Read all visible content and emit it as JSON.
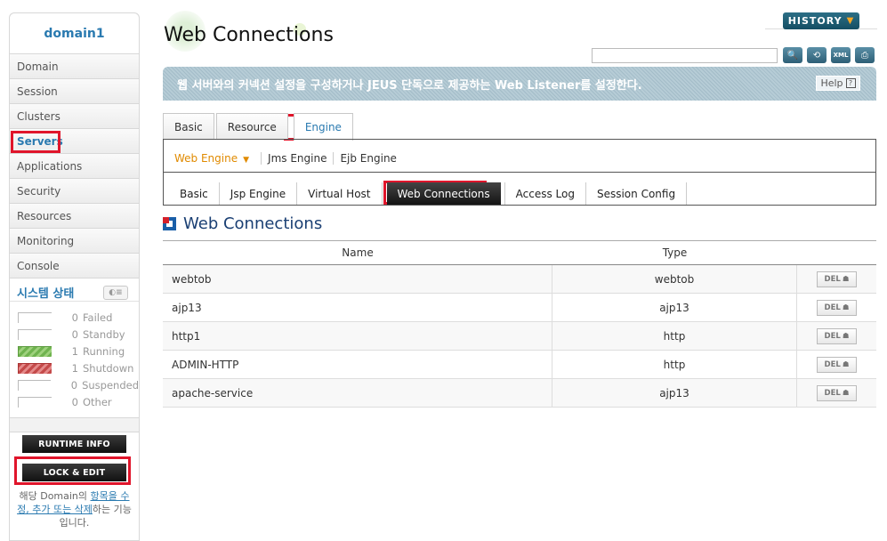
{
  "sidebar": {
    "domain": "domain1",
    "items": [
      {
        "label": "Domain"
      },
      {
        "label": "Session"
      },
      {
        "label": "Clusters"
      },
      {
        "label": "Servers"
      },
      {
        "label": "Applications"
      },
      {
        "label": "Security"
      },
      {
        "label": "Resources"
      },
      {
        "label": "Monitoring"
      },
      {
        "label": "Console"
      }
    ],
    "status_title": "시스템 상태",
    "status_toggle": "◐≡",
    "status": [
      {
        "count": "0",
        "label": "Failed"
      },
      {
        "count": "0",
        "label": "Standby"
      },
      {
        "count": "1",
        "label": "Running"
      },
      {
        "count": "1",
        "label": "Shutdown"
      },
      {
        "count": "0",
        "label": "Suspended"
      },
      {
        "count": "0",
        "label": "Other"
      }
    ],
    "runtime_btn": "RUNTIME INFO",
    "lock_btn": "LOCK & EDIT",
    "note_pre": "해당 Domain의 ",
    "note_link1": "항목을 수정, 추가 또는 삭제",
    "note_post": "하는 기능입니다."
  },
  "header": {
    "title": "Web Connections",
    "history": "HISTORY",
    "history_chevron": "❯",
    "search_value": "",
    "tools": [
      "🔍",
      "⟲",
      "XML",
      "⎙"
    ]
  },
  "banner": {
    "text": "웹 서버와의 커넥션 설정을 구성하거나 JEUS 단독으로 제공하는 Web Listener를 설정한다.",
    "help": "Help",
    "help_icon": "?"
  },
  "tabs1": [
    "Basic",
    "Resource",
    "Engine"
  ],
  "sub1": [
    "Web Engine",
    "Jms Engine",
    "Ejb Engine"
  ],
  "tabs2": [
    "Basic",
    "Jsp Engine",
    "Virtual Host",
    "Web Connections",
    "Access Log",
    "Session Config"
  ],
  "section": {
    "title": "Web Connections"
  },
  "table": {
    "headers": {
      "name": "Name",
      "type": "Type"
    },
    "del_label": "DEL",
    "rows": [
      {
        "name": "webtob",
        "type": "webtob"
      },
      {
        "name": "ajp13",
        "type": "ajp13"
      },
      {
        "name": "http1",
        "type": "http"
      },
      {
        "name": "ADMIN-HTTP",
        "type": "http"
      },
      {
        "name": "apache-service",
        "type": "ajp13"
      }
    ]
  }
}
